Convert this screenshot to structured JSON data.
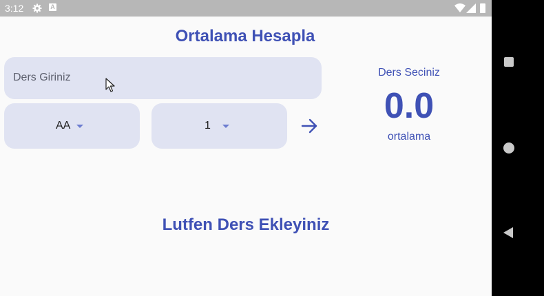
{
  "status_bar": {
    "time": "3:12",
    "icons": [
      "gear-icon",
      "a-notification-icon",
      "wifi-icon",
      "signal-icon",
      "battery-icon"
    ]
  },
  "app": {
    "title": "Ortalama Hesapla",
    "course_input": {
      "placeholder": "Ders Giriniz",
      "value": ""
    },
    "grade_dropdown": {
      "selected": "AA"
    },
    "credit_dropdown": {
      "selected": "1"
    },
    "add_button_icon": "arrow-right-icon",
    "average_panel": {
      "label": "Ders Seciniz",
      "value": "0.0",
      "sublabel": "ortalama"
    },
    "empty_message": "Lutfen Ders Ekleyiniz"
  },
  "nav_bar": {
    "icons": [
      "recent-apps-icon",
      "home-icon",
      "back-icon"
    ]
  },
  "colors": {
    "accent": "#3f51b5",
    "field_bg": "#e0e3f2",
    "screen_bg": "#fafafa",
    "status_bar": "#b7b7b7",
    "caret": "#6d7dd0"
  }
}
